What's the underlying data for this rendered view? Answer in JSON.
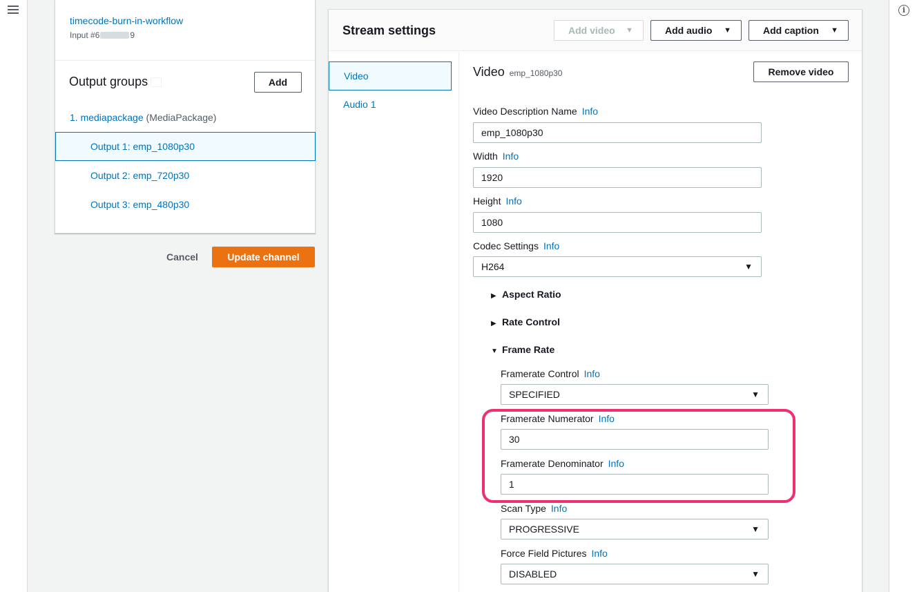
{
  "left_card": {
    "input_name": "timecode-burn-in-workflow",
    "input_id_prefix": "Input #6",
    "input_id_suffix": "9",
    "output_groups_title": "Output groups",
    "add_label": "Add",
    "group": {
      "name": "1. mediapackage",
      "type": "(MediaPackage)"
    },
    "outputs": [
      "Output 1: emp_1080p30",
      "Output 2: emp_720p30",
      "Output 3: emp_480p30"
    ]
  },
  "actions": {
    "cancel": "Cancel",
    "update": "Update channel"
  },
  "stream": {
    "title": "Stream settings",
    "add_video": "Add video",
    "add_audio": "Add audio",
    "add_caption": "Add caption",
    "tabs": [
      "Video",
      "Audio 1"
    ],
    "video_title": "Video",
    "video_subtitle": "emp_1080p30",
    "remove_video": "Remove video",
    "info": "Info",
    "fields": {
      "desc_label": "Video Description Name",
      "desc_value": "emp_1080p30",
      "width_label": "Width",
      "width_value": "1920",
      "height_label": "Height",
      "height_value": "1080",
      "codec_label": "Codec Settings",
      "codec_value": "H264",
      "aspect": "Aspect Ratio",
      "rate": "Rate Control",
      "frame_rate": "Frame Rate",
      "fr_control_label": "Framerate Control",
      "fr_control_value": "SPECIFIED",
      "fr_num_label": "Framerate Numerator",
      "fr_num_value": "30",
      "fr_den_label": "Framerate Denominator",
      "fr_den_value": "1",
      "scan_label": "Scan Type",
      "scan_value": "PROGRESSIVE",
      "force_label": "Force Field Pictures",
      "force_value": "DISABLED"
    }
  },
  "icons": {
    "menu": "hamburger-menu-icon",
    "help": "info-circle-icon"
  },
  "colors": {
    "link": "#0073bb",
    "primary": "#ec7211",
    "highlight": "#f0306e"
  }
}
